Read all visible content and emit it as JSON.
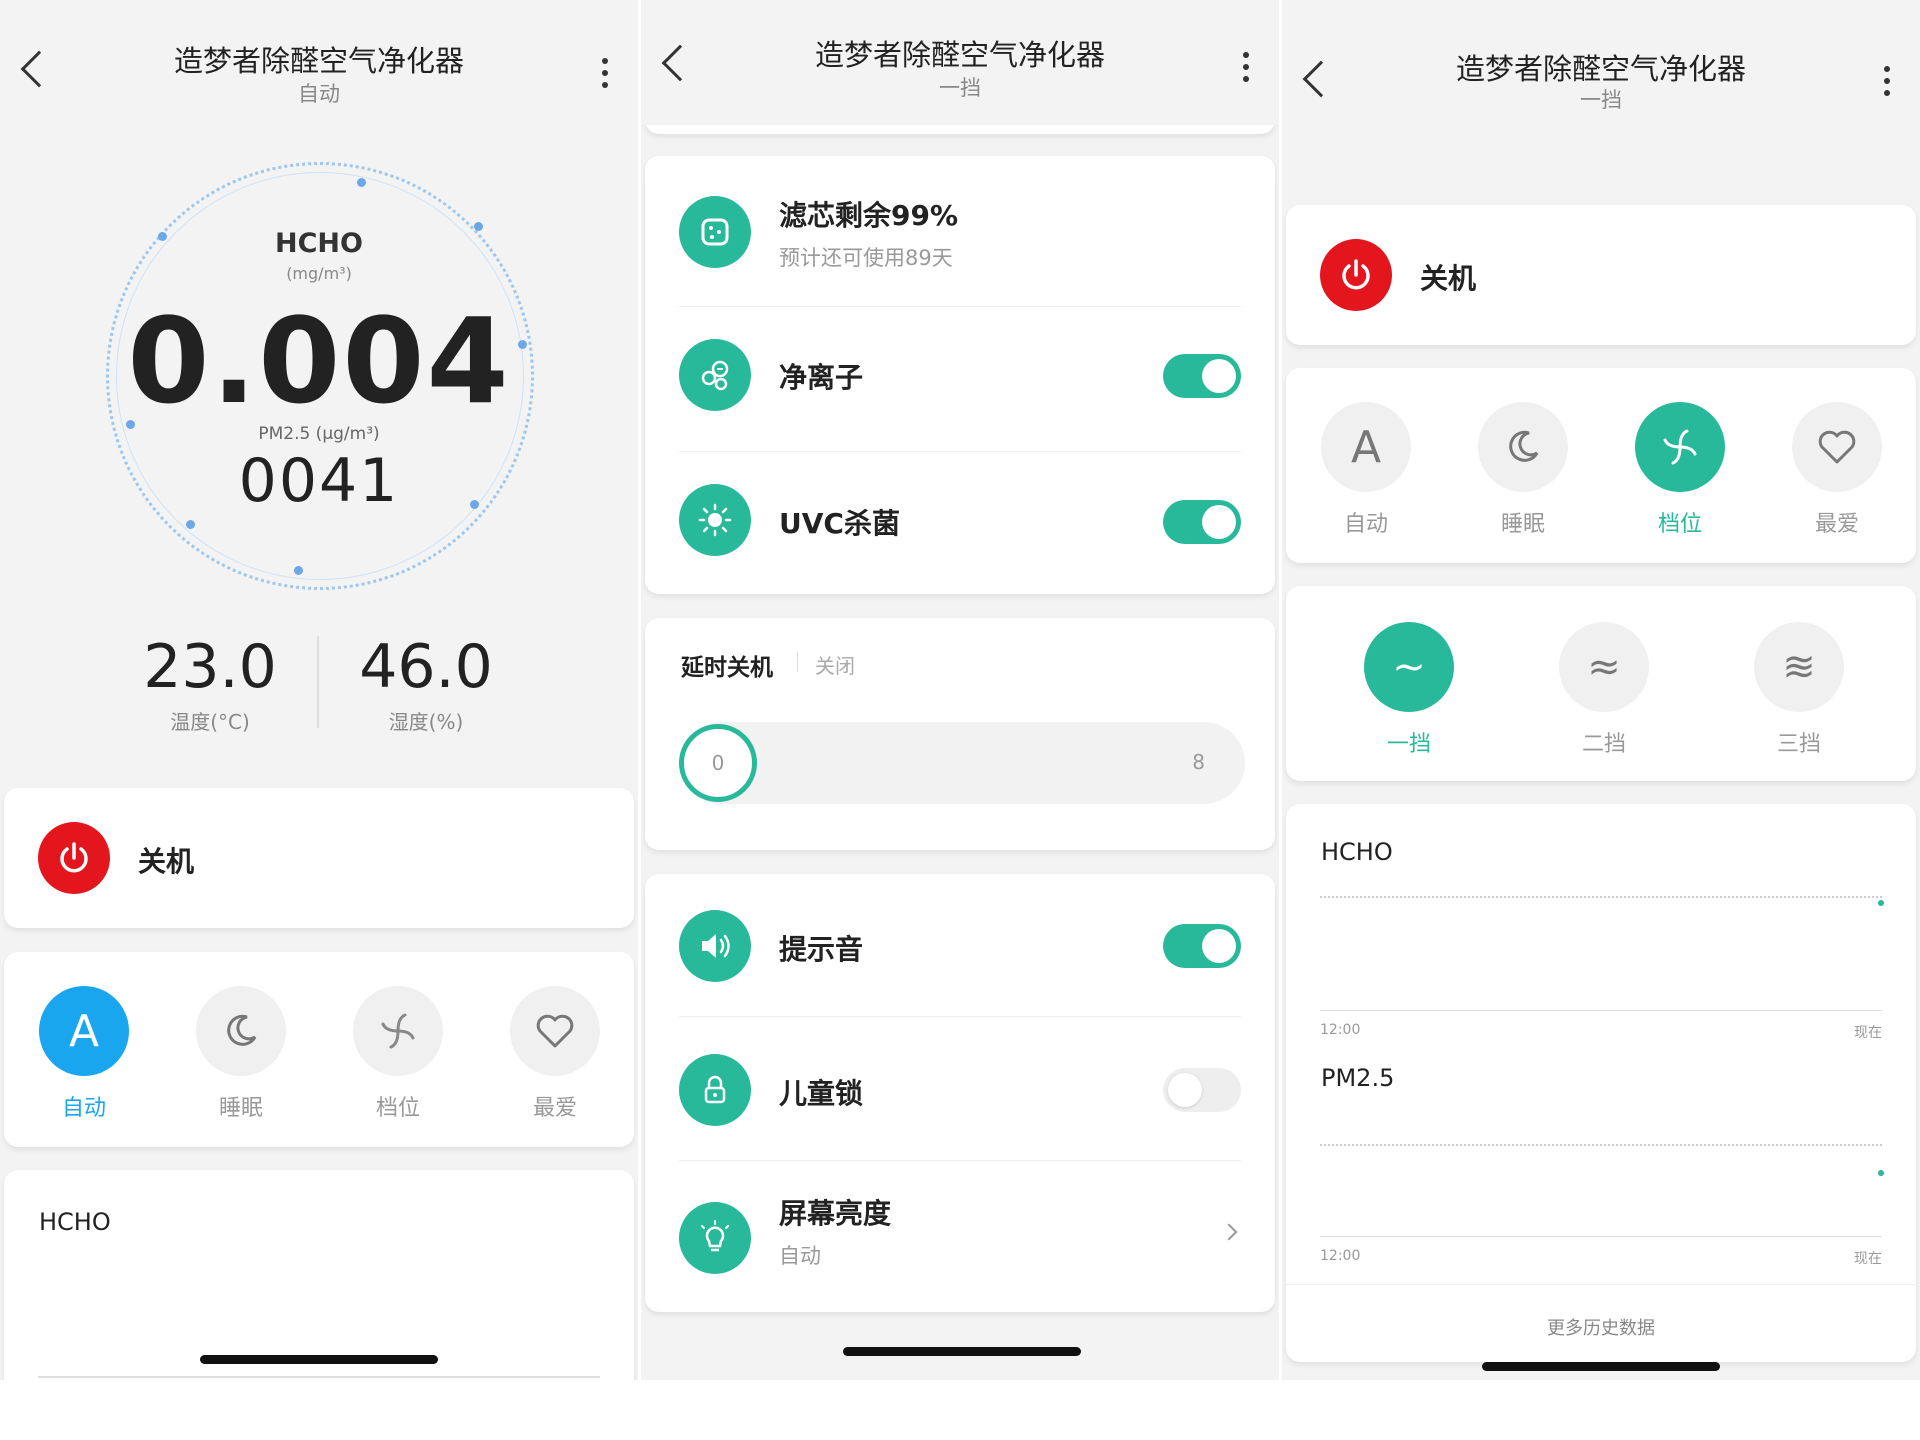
{
  "device_name": "造梦者除醛空气净化器",
  "panel1": {
    "subtitle": "自动",
    "gauge": {
      "title": "HCHO",
      "unit": "(mg/m³)",
      "value": "0.004",
      "pm_label": "PM2.5 (μg/m³)",
      "pm_value": "0041"
    },
    "temperature": {
      "value": "23.0",
      "label": "温度(°C)"
    },
    "humidity": {
      "value": "46.0",
      "label": "湿度(%)"
    },
    "power_label": "关机",
    "modes": [
      {
        "label": "自动",
        "icon": "A"
      },
      {
        "label": "睡眠",
        "icon": "moon-icon"
      },
      {
        "label": "档位",
        "icon": "fan-icon"
      },
      {
        "label": "最爱",
        "icon": "heart-icon"
      }
    ],
    "active_mode": "自动",
    "chart_title": "HCHO"
  },
  "panel2": {
    "subtitle": "一挡",
    "filter": {
      "title": "滤芯剩余99%",
      "sub": "预计还可使用89天"
    },
    "ion": {
      "title": "净离子",
      "on": true
    },
    "uvc": {
      "title": "UVC杀菌",
      "on": true
    },
    "timer": {
      "title": "延时关机",
      "status": "关闭",
      "min": "0",
      "max": "8",
      "value": 0
    },
    "beep": {
      "title": "提示音",
      "on": true
    },
    "child_lock": {
      "title": "儿童锁",
      "on": false
    },
    "brightness": {
      "title": "屏幕亮度",
      "sub": "自动"
    }
  },
  "panel3": {
    "subtitle": "一挡",
    "power_label": "关机",
    "modes": [
      {
        "label": "自动",
        "icon": "A"
      },
      {
        "label": "睡眠",
        "icon": "moon-icon"
      },
      {
        "label": "档位",
        "icon": "fan-icon"
      },
      {
        "label": "最爱",
        "icon": "heart-icon"
      }
    ],
    "active_mode": "档位",
    "gears": [
      {
        "label": "一挡",
        "icon": "~"
      },
      {
        "label": "二挡",
        "icon": "≈"
      },
      {
        "label": "三挡",
        "icon": "≋"
      }
    ],
    "active_gear": "一挡",
    "charts": [
      {
        "title": "HCHO",
        "x_start": "12:00",
        "x_end": "现在"
      },
      {
        "title": "PM2.5",
        "x_start": "12:00",
        "x_end": "现在"
      }
    ],
    "more_history": "更多历史数据"
  },
  "colors": {
    "accent_green": "#28b99a",
    "accent_blue": "#1aa6ee",
    "power_red": "#e3161e"
  }
}
